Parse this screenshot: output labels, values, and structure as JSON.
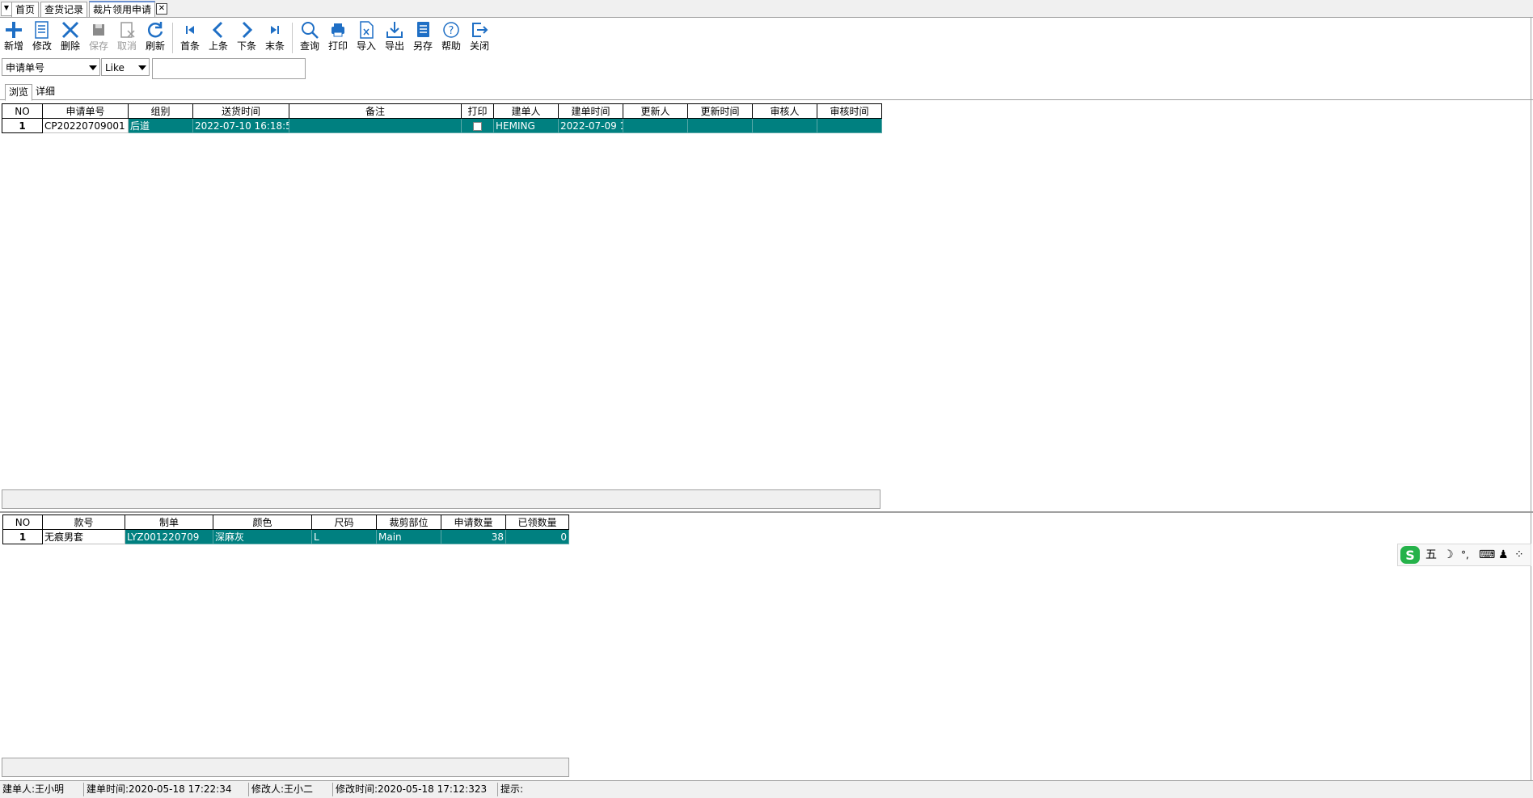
{
  "tabs": {
    "items": [
      {
        "label": "首页"
      },
      {
        "label": "查货记录"
      },
      {
        "label": "裁片领用申请"
      }
    ],
    "close_glyph": "✕"
  },
  "toolbar": {
    "new": "新增",
    "edit": "修改",
    "delete": "删除",
    "save": "保存",
    "cancel": "取消",
    "refresh": "刷新",
    "first": "首条",
    "prev": "上条",
    "next": "下条",
    "last": "末条",
    "query": "查询",
    "print": "打印",
    "import": "导入",
    "export": "导出",
    "saveas": "另存",
    "help": "帮助",
    "close": "关闭"
  },
  "filter": {
    "field": "申请单号",
    "operator": "Like",
    "value": ""
  },
  "subtabs": [
    "浏览",
    "详细"
  ],
  "master": {
    "columns": [
      "NO",
      "申请单号",
      "组别",
      "送货时间",
      "备注",
      "打印",
      "建单人",
      "建单时间",
      "更新人",
      "更新时间",
      "审核人",
      "审核时间"
    ],
    "rows": [
      {
        "no": "1",
        "order_no": "CP20220709001",
        "group": "后道",
        "delivery_time": "2022-07-10 16:18:5",
        "remark": "",
        "creator": "HEMING",
        "create_time": "2022-07-09 1",
        "updater": "",
        "update_time": "",
        "auditor": "",
        "audit_time": ""
      }
    ]
  },
  "detail": {
    "columns": [
      "NO",
      "款号",
      "制单",
      "颜色",
      "尺码",
      "裁剪部位",
      "申请数量",
      "已领数量"
    ],
    "rows": [
      {
        "no": "1",
        "style": "无痕男套",
        "order": "LYZ001220709",
        "color": "深麻灰",
        "size": "L",
        "part": "Main",
        "qty": "38",
        "received": "0"
      }
    ]
  },
  "ime": {
    "mode": "五",
    "moon": "☽",
    "punct": "°,",
    "keyboard": "⌨",
    "user": "♟",
    "grid": "⁘"
  },
  "status": {
    "creator": "建单人:王小明",
    "create_time": "建单时间:2020-05-18 17:22:34",
    "modifier": "修改人:王小二",
    "modify_time": "修改时间:2020-05-18 17:12:323",
    "hint": "提示:"
  },
  "colors": {
    "selected_row": "#008080",
    "toolbar_icon": "#1f6fc5"
  }
}
